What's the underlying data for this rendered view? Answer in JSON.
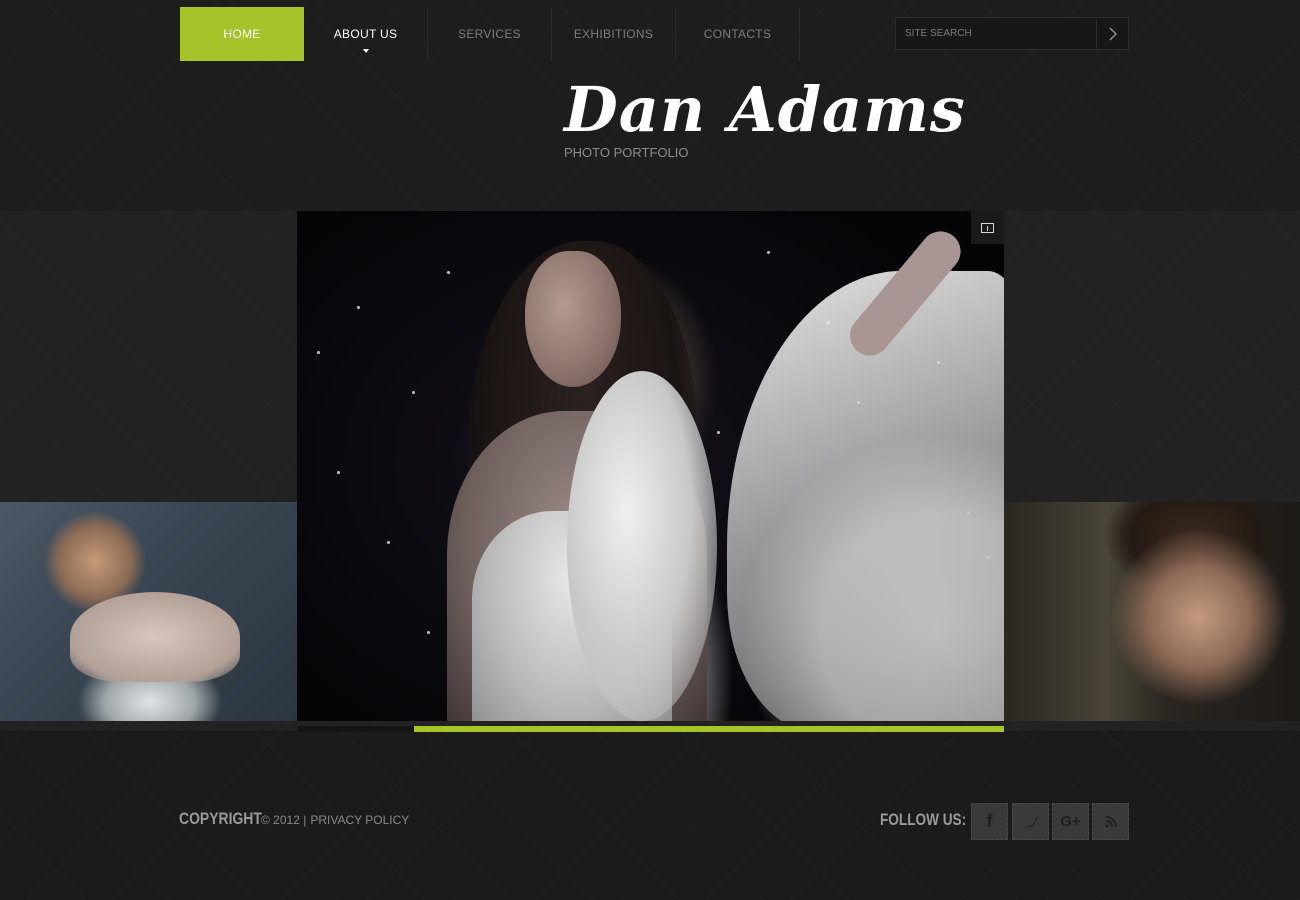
{
  "nav": {
    "items": [
      {
        "label": "HOME",
        "state": "active"
      },
      {
        "label": "ABOUT US",
        "state": "hover"
      },
      {
        "label": "SERVICES",
        "state": "normal"
      },
      {
        "label": "EXHIBITIONS",
        "state": "normal"
      },
      {
        "label": "CONTACTS",
        "state": "normal"
      }
    ]
  },
  "search": {
    "placeholder": "SITE SEARCH",
    "button_icon": "arrow-right-icon"
  },
  "logo": {
    "name": "Dan Adams",
    "tagline": "PHOTO PORTFOLIO"
  },
  "slider": {
    "fullscreen_icon": "fullscreen-icon",
    "progress": 0.835
  },
  "footer": {
    "copyright_label": "COPYRIGHT",
    "copyright_text": "© 2012 |",
    "privacy_link": "PRIVACY POLICY",
    "follow_label": "FOLLOW US:",
    "social": [
      {
        "icon": "facebook-icon",
        "glyph": "f"
      },
      {
        "icon": "twitter-icon",
        "glyph": "t"
      },
      {
        "icon": "google-plus-icon",
        "glyph": "G+"
      },
      {
        "icon": "rss-icon",
        "glyph": "rss"
      }
    ]
  },
  "colors": {
    "accent": "#a6c42a",
    "background": "#1b1b1b",
    "text_muted": "#7d7d7d"
  }
}
